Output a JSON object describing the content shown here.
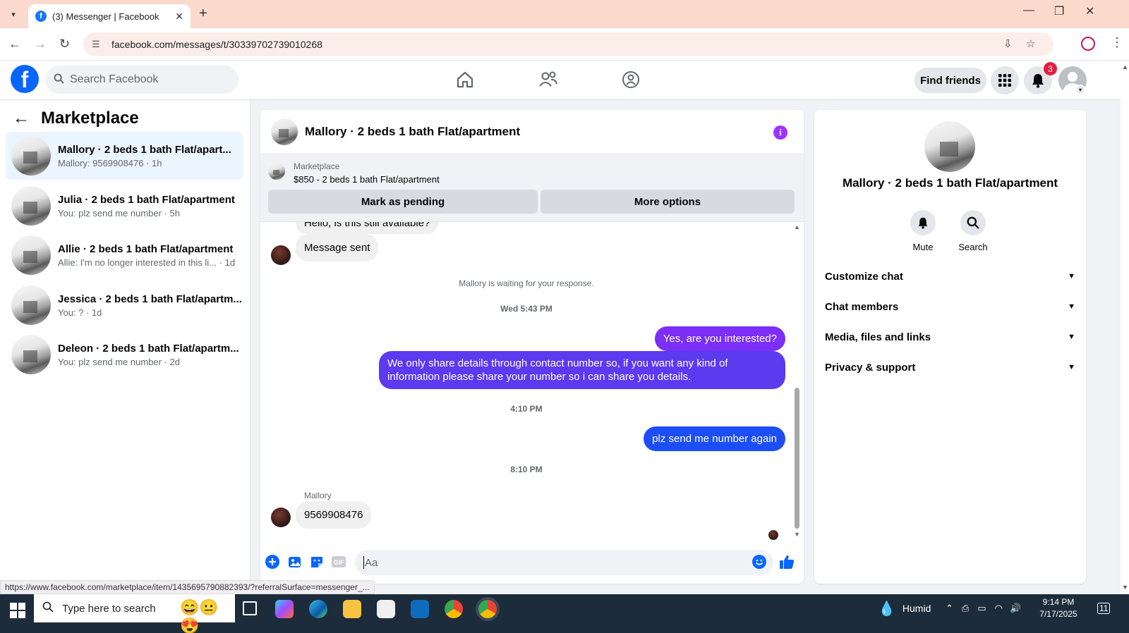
{
  "browser": {
    "tab_title": "(3) Messenger | Facebook",
    "url": "facebook.com/messages/t/30339702739010268",
    "status_url": "https://www.facebook.com/marketplace/item/1435695790882393/?referralSurface=messenger_..."
  },
  "fb_header": {
    "search_placeholder": "Search Facebook",
    "find_friends": "Find friends",
    "notification_count": "3"
  },
  "sidebar": {
    "title": "Marketplace",
    "conversations": [
      {
        "name": "Mallory · 2 beds 1 bath Flat/apart...",
        "preview": "Mallory: 9569908476 · 1h",
        "active": true
      },
      {
        "name": "Julia · 2 beds 1 bath Flat/apartment",
        "preview": "You: plz send me number · 5h",
        "active": false
      },
      {
        "name": "Allie · 2 beds 1 bath Flat/apartment",
        "preview": "Allie: I'm no longer interested in this li... · 1d",
        "active": false
      },
      {
        "name": "Jessica · 2 beds 1 bath Flat/apartm...",
        "preview": "You: ? · 1d",
        "active": false
      },
      {
        "name": "Deleon · 2 beds 1 bath Flat/apartm...",
        "preview": "You: plz send me number · 2d",
        "active": false
      }
    ]
  },
  "chat": {
    "title": "Mallory · 2 beds 1 bath Flat/apartment",
    "marketplace_label": "Marketplace",
    "listing": "$850 - 2 beds 1 bath Flat/apartment",
    "mark_pending": "Mark as pending",
    "more_options": "More options",
    "messages": {
      "cut_off": "Hello, is this still available?",
      "msg_sent": "Message sent",
      "waiting": "Mallory is waiting for your response.",
      "ts1": "Wed 5:43 PM",
      "out1": "Yes, are you interested?",
      "out2": "We only share details through contact number so, if you want any kind of information please share your number so i can share you details.",
      "ts2": "4:10 PM",
      "out3": "plz  send me number again",
      "ts3": "8:10 PM",
      "sender": "Mallory",
      "in_last": "9569908476"
    },
    "composer_placeholder": "Aa"
  },
  "details": {
    "name": "Mallory · 2 beds 1 bath Flat/apartment",
    "mute": "Mute",
    "search": "Search",
    "rows": [
      "Customize chat",
      "Chat members",
      "Media, files and links",
      "Privacy & support"
    ]
  },
  "taskbar": {
    "search_placeholder": "Type here to search",
    "weather": "Humid",
    "time": "9:14 PM",
    "date": "7/17/2025",
    "notif": "11"
  }
}
